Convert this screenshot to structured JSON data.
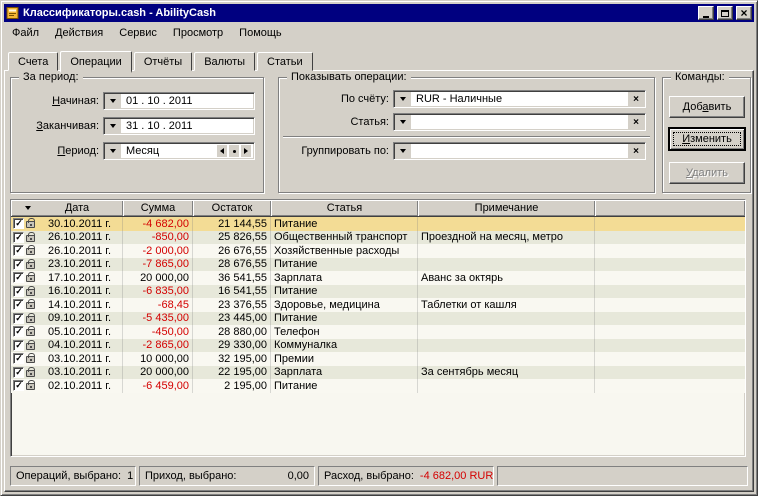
{
  "window": {
    "title": "Классификаторы.cash - AbilityCash"
  },
  "icons": {
    "check": "✓",
    "clear": "×"
  },
  "menu": {
    "items": [
      "Файл",
      "Действия",
      "Сервис",
      "Просмотр",
      "Помощь"
    ]
  },
  "tabs": [
    "Счета",
    "Операции",
    "Отчёты",
    "Валюты",
    "Статьи"
  ],
  "filters": {
    "period": {
      "title": "За период:",
      "start_label": {
        "mn": "Н",
        "rest": "ачиная:"
      },
      "start_value": "01 . 10 . 2011",
      "end_label": {
        "mn": "З",
        "rest": "аканчивая:"
      },
      "end_value": "31 . 10 . 2011",
      "period_label": {
        "mn": "П",
        "rest": "ериод:"
      },
      "period_value": "Месяц"
    },
    "show": {
      "title": "Показывать операции:",
      "account_label": "По счёту:",
      "account_value": "RUR - Наличные",
      "article_label": "Статья:",
      "article_value": "",
      "group_label": "Группировать по:",
      "group_value": ""
    },
    "commands": {
      "title": "Команды:",
      "add": {
        "pre": "Доб",
        "mn": "а",
        "post": "вить"
      },
      "edit": {
        "pre": "",
        "mn": "И",
        "post": "зменить"
      },
      "delete": {
        "pre": "",
        "mn": "У",
        "post": "далить"
      }
    }
  },
  "table": {
    "headers": {
      "date": "Дата",
      "sum": "Сумма",
      "balance": "Остаток",
      "article": "Статья",
      "note": "Примечание"
    },
    "rows": [
      {
        "date": "30.10.2011 г.",
        "sum": "-4 682,00",
        "balance": "21 144,55",
        "article": "Питание",
        "note": ""
      },
      {
        "date": "26.10.2011 г.",
        "sum": "-850,00",
        "balance": "25 826,55",
        "article": "Общественный транспорт",
        "note": "Проездной на месяц, метро"
      },
      {
        "date": "26.10.2011 г.",
        "sum": "-2 000,00",
        "balance": "26 676,55",
        "article": "Хозяйственные расходы",
        "note": ""
      },
      {
        "date": "23.10.2011 г.",
        "sum": "-7 865,00",
        "balance": "28 676,55",
        "article": "Питание",
        "note": ""
      },
      {
        "date": "17.10.2011 г.",
        "sum": "20 000,00",
        "balance": "36 541,55",
        "article": "Зарплата",
        "note": "Аванс за октярь"
      },
      {
        "date": "16.10.2011 г.",
        "sum": "-6 835,00",
        "balance": "16 541,55",
        "article": "Питание",
        "note": ""
      },
      {
        "date": "14.10.2011 г.",
        "sum": "-68,45",
        "balance": "23 376,55",
        "article": "Здоровье, медицина",
        "note": "Таблетки от кашля"
      },
      {
        "date": "09.10.2011 г.",
        "sum": "-5 435,00",
        "balance": "23 445,00",
        "article": "Питание",
        "note": ""
      },
      {
        "date": "05.10.2011 г.",
        "sum": "-450,00",
        "balance": "28 880,00",
        "article": "Телефон",
        "note": ""
      },
      {
        "date": "04.10.2011 г.",
        "sum": "-2 865,00",
        "balance": "29 330,00",
        "article": "Коммуналка",
        "note": ""
      },
      {
        "date": "03.10.2011 г.",
        "sum": "10 000,00",
        "balance": "32 195,00",
        "article": "Премии",
        "note": ""
      },
      {
        "date": "03.10.2011 г.",
        "sum": "20 000,00",
        "balance": "22 195,00",
        "article": "Зарплата",
        "note": "За сентябрь месяц"
      },
      {
        "date": "02.10.2011 г.",
        "sum": "-6 459,00",
        "balance": "2 195,00",
        "article": "Питание",
        "note": ""
      }
    ]
  },
  "statusbar": {
    "operations_label": "Операций, выбрано:",
    "operations_value": "1",
    "income_label": "Приход, выбрано:",
    "income_value": "0,00",
    "expense_label": "Расход, выбрано:",
    "expense_value": "-4 682,00 RUR"
  },
  "colors": {
    "titlebar": "#000080",
    "selected_row": "#f3dc95",
    "negative_amount": "#d40000",
    "row_alt": "#e7e8da",
    "row_base": "#f9f8f1"
  }
}
